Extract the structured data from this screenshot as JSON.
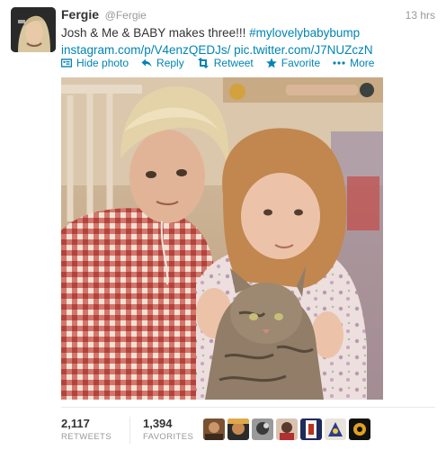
{
  "tweet": {
    "display_name": "Fergie",
    "screen_name": "@Fergie",
    "timestamp": "13 hrs",
    "text_plain": "Josh & Me & BABY makes three!!! ",
    "hashtag": "#mylovelybabybump",
    "link_instagram": "instagram.com/p/V4enzQEDJs/",
    "link_twitter": "pic.twitter.com/J7NUZczN"
  },
  "actions": {
    "hide_photo": "Hide photo",
    "reply": "Reply",
    "retweet": "Retweet",
    "favorite": "Favorite",
    "more": "More"
  },
  "stats": {
    "retweets_count": "2,117",
    "retweets_label": "RETWEETS",
    "favorites_count": "1,394",
    "favorites_label": "FAVORITES"
  },
  "colors": {
    "link": "#0084b4",
    "muted": "#999999",
    "text": "#333333"
  },
  "icons": [
    "photo-icon",
    "reply-icon",
    "retweet-icon",
    "star-icon",
    "ellipsis-icon"
  ]
}
